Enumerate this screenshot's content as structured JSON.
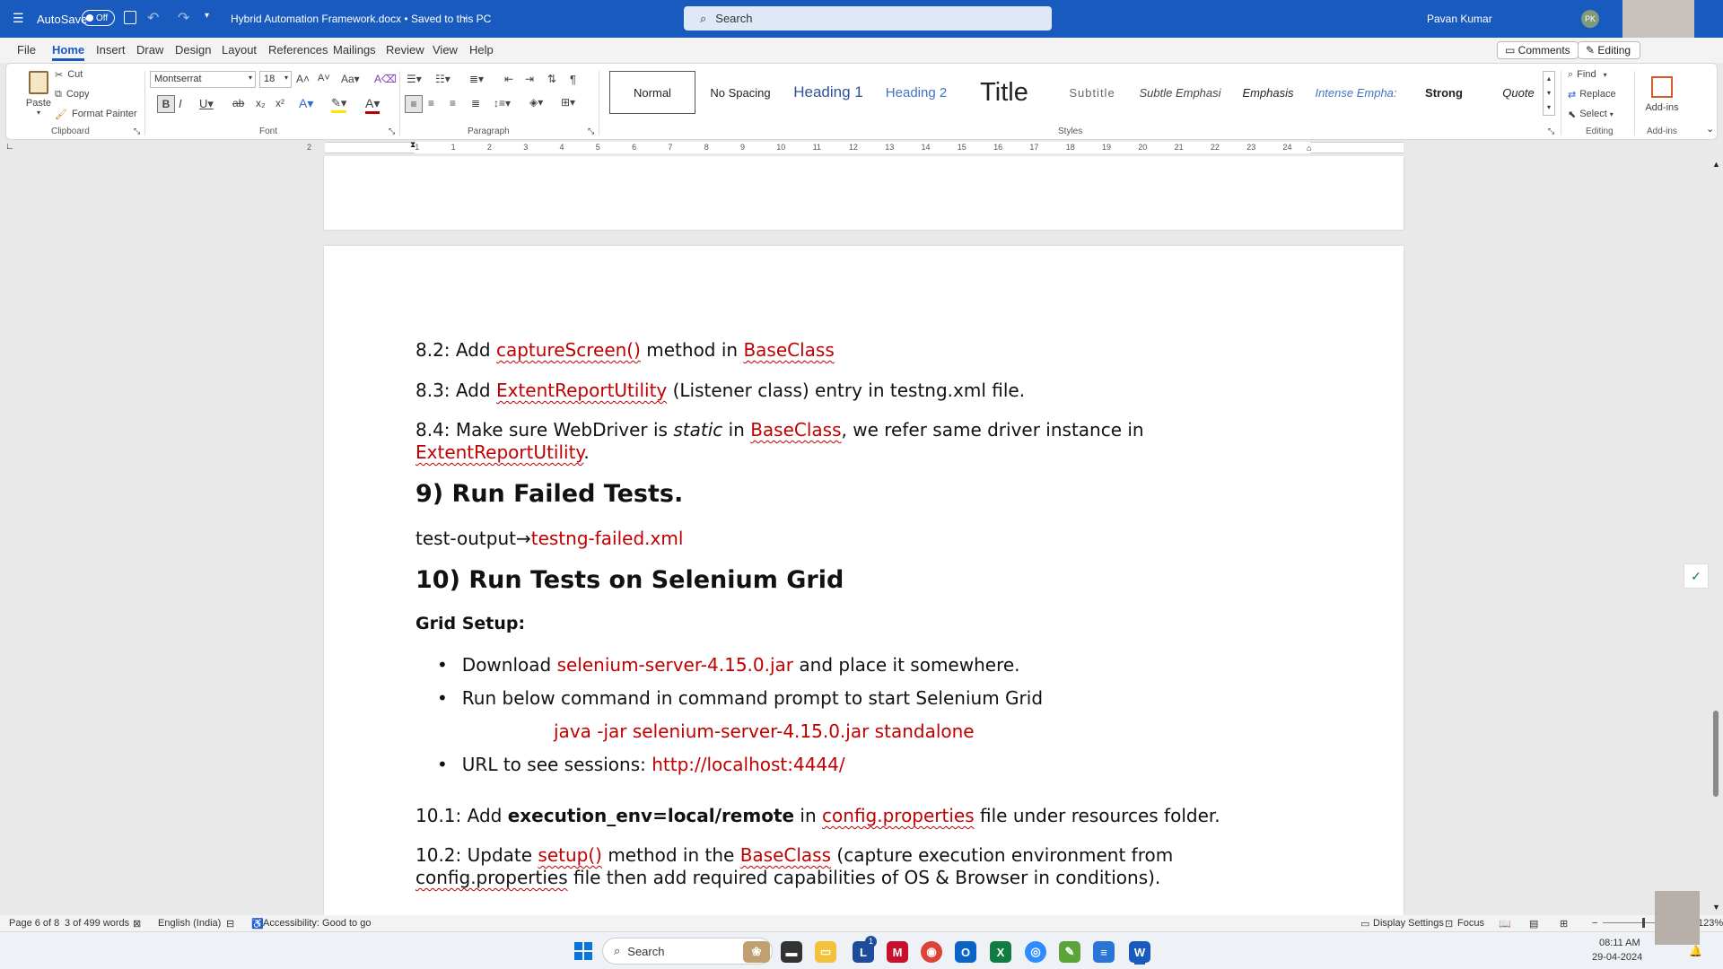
{
  "titlebar": {
    "autosave_label": "AutoSave",
    "autosave_state": "Off",
    "doc_title": "Hybrid Automation Framework.docx • Saved to this PC",
    "search_placeholder": "Search",
    "user_name": "Pavan Kumar",
    "user_initials": "PK"
  },
  "menu": [
    "File",
    "Home",
    "Insert",
    "Draw",
    "Design",
    "Layout",
    "References",
    "Mailings",
    "Review",
    "View",
    "Help"
  ],
  "menu_active": "Home",
  "menu_right": {
    "comments": "Comments",
    "editing": "Editing"
  },
  "ribbon": {
    "clipboard": {
      "paste": "Paste",
      "cut": "Cut",
      "copy": "Copy",
      "format_painter": "Format Painter",
      "group": "Clipboard"
    },
    "font": {
      "name": "Montserrat",
      "size": "18",
      "group": "Font"
    },
    "paragraph": {
      "group": "Paragraph"
    },
    "styles": {
      "items": [
        "Normal",
        "No Spacing",
        "Heading 1",
        "Heading 2",
        "Title",
        "Subtitle",
        "Subtle Emphasi",
        "Emphasis",
        "Intense Empha:",
        "Strong",
        "Quote"
      ],
      "group": "Styles"
    },
    "editing": {
      "find": "Find",
      "replace": "Replace",
      "select": "Select",
      "group": "Editing"
    },
    "addins": {
      "label": "Add-ins",
      "group": "Add-ins"
    }
  },
  "ruler_numbers": [
    "2",
    "1",
    "1",
    "2",
    "3",
    "4",
    "5",
    "6",
    "7",
    "8",
    "9",
    "10",
    "11",
    "12",
    "13",
    "14",
    "15",
    "16",
    "17",
    "18",
    "19",
    "20",
    "21",
    "22",
    "23",
    "24"
  ],
  "document": {
    "p82": {
      "a": "8.2: Add ",
      "b": "captureScreen()",
      "c": " method in ",
      "d": "BaseClass"
    },
    "p83": {
      "a": "8.3: Add ",
      "b": "ExtentReportUtility",
      "c": " (Listener class) entry in testng.xml file."
    },
    "p84": {
      "a": "8.4: Make sure WebDriver is ",
      "b": "static",
      "c": " in ",
      "d": "BaseClass",
      "e": ", we refer same driver instance in",
      "f": "ExtentReportUtility",
      "g": "."
    },
    "h9": "9) Run Failed Tests.",
    "p9": {
      "a": "test-output",
      "b": "→",
      "c": "testng-failed.xml"
    },
    "h10": "10) Run Tests on Selenium Grid",
    "grid_setup": "Grid Setup:",
    "bullets": {
      "b1a": "Download ",
      "b1b": "selenium-server-4.15.0.jar",
      "b1c": " and place it somewhere.",
      "b2": "Run below command in command prompt to start Selenium Grid",
      "cmd": "java -jar selenium-server-4.15.0.jar standalone",
      "b3a": "URL to see sessions:  ",
      "b3b": "http://localhost:4444/"
    },
    "p101": {
      "a": "10.1: Add ",
      "b": "execution_env=local/remote",
      "c": " in ",
      "d": "config.properties",
      "e": " file under resources folder."
    },
    "p102": {
      "a": "10.2: Update ",
      "b": "setup()",
      "c": " method in the ",
      "d": "BaseClass",
      "e": " (capture execution environment from",
      "f": "config.properties",
      "g": " file then add required capabilities of OS & Browser in conditions)."
    }
  },
  "status": {
    "page": "Page 6 of 8",
    "words": "3 of 499 words",
    "language": "English (India)",
    "accessibility": "Accessibility: Good to go",
    "display_settings": "Display Settings",
    "focus": "Focus",
    "zoom": "123%"
  },
  "taskbar": {
    "search": "Search",
    "time": "08:11 AM",
    "date": "29-04-2024",
    "badge": "1"
  },
  "colors": {
    "title_blue": "#185abd",
    "doc_red": "#c00000"
  }
}
